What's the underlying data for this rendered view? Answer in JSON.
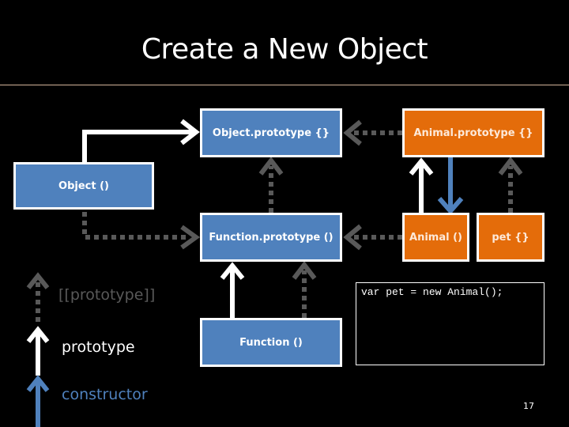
{
  "slide": {
    "title": "Create a New Object",
    "page_number": "17"
  },
  "nodes": {
    "object_prototype": "Object.prototype {}",
    "animal_prototype": "Animal.prototype {}",
    "object_ctor": "Object ()",
    "function_prototype": "Function.prototype ()",
    "animal_ctor": "Animal ()",
    "pet": "pet {}",
    "function_ctor": "Function ()"
  },
  "code": "var pet = new Animal();",
  "legend": {
    "proto_link": "[[prototype]]",
    "prototype": "prototype",
    "constructor": "constructor"
  },
  "colors": {
    "blue_box": "#4f81bd",
    "orange_box": "#e46c0a",
    "proto_link": "#595959",
    "prototype_arrow": "#ffffff",
    "constructor_arrow": "#4f81bd"
  }
}
